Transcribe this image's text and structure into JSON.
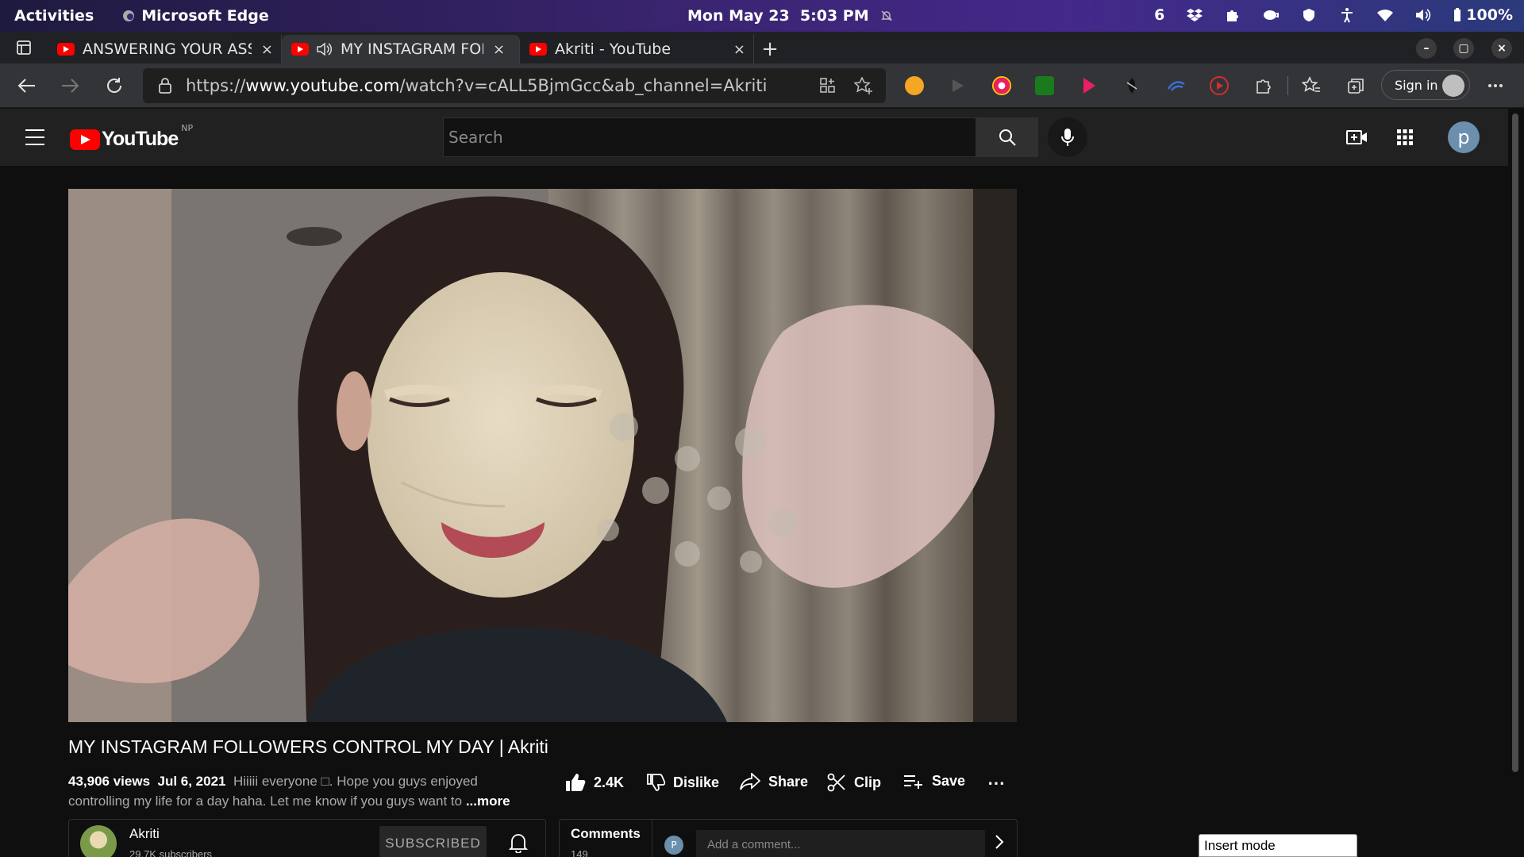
{
  "topbar": {
    "activities": "Activities",
    "app_name": "Microsoft Edge",
    "datetime": "Mon May 23  5:03 PM",
    "workspace_count": "6",
    "battery": "100%"
  },
  "tabs": [
    {
      "title": "ANSWERING YOUR ASSU",
      "close": "×"
    },
    {
      "title": "MY INSTAGRAM FOLL",
      "close": "×"
    },
    {
      "title": "Akriti - YouTube",
      "close": "×"
    }
  ],
  "newtab": "+",
  "window": {
    "minimize": "–",
    "maximize": "▢",
    "close": "×"
  },
  "url": {
    "scheme": "https://",
    "host": "www.youtube.com",
    "path": "/watch?v=cALL5BjmGcc&ab_channel=Akriti"
  },
  "signin_label": "Sign in",
  "youtube": {
    "logo_text": "YouTube",
    "country": "NP",
    "search_placeholder": "Search",
    "avatar_letter": "p"
  },
  "video": {
    "title": "MY INSTAGRAM FOLLOWERS CONTROL MY DAY | Akriti",
    "views": "43,906 views",
    "date": "Jul 6, 2021",
    "description": "Hiiiii everyone □. Hope you guys enjoyed controlling my life for a day haha. Let me know if you guys want to",
    "more": "...more"
  },
  "actions": {
    "like_count": "2.4K",
    "dislike": "Dislike",
    "share": "Share",
    "clip": "Clip",
    "save": "Save",
    "more": "⋯"
  },
  "channel": {
    "name": "Akriti",
    "subscribers": "29.7K subscribers",
    "subscribed_label": "SUBSCRIBED"
  },
  "comments": {
    "label": "Comments",
    "count": "149",
    "avatar_letter": "P",
    "placeholder": "Add a comment..."
  },
  "insert_mode": "Insert mode",
  "colors": {
    "youtube_red": "#ff0000",
    "background": "#0f0f0f",
    "masthead": "#212121"
  }
}
